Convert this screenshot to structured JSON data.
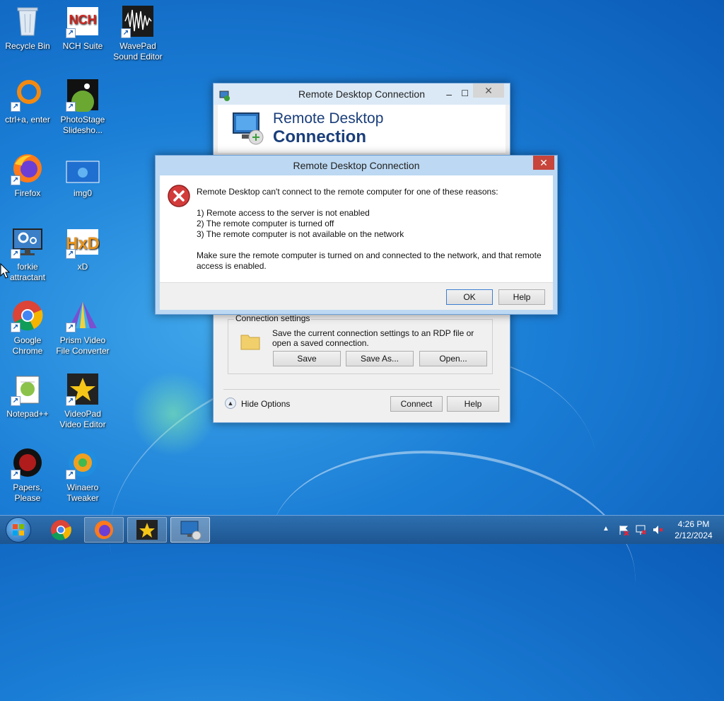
{
  "desktop": {
    "icons": [
      {
        "label": "Recycle Bin"
      },
      {
        "label": "NCH Suite"
      },
      {
        "label": "WavePad Sound Editor"
      },
      {
        "label": "ctrl+a, enter"
      },
      {
        "label": "PhotoStage Slidesho..."
      },
      {
        "label": "Firefox"
      },
      {
        "label": "img0"
      },
      {
        "label": "forkie attractant"
      },
      {
        "label": "xD"
      },
      {
        "label": "Google Chrome"
      },
      {
        "label": "Prism Video File Converter"
      },
      {
        "label": "Notepad++"
      },
      {
        "label": "VideoPad Video Editor"
      },
      {
        "label": "Papers, Please"
      },
      {
        "label": "Winaero Tweaker"
      }
    ]
  },
  "rdc_window": {
    "title": "Remote Desktop Connection",
    "banner_line1": "Remote Desktop",
    "banner_line2": "Connection",
    "connection_settings_label": "Connection settings",
    "connection_settings_text": "Save the current connection settings to an RDP file or open a saved connection.",
    "save_label": "Save",
    "save_as_label": "Save As...",
    "open_label": "Open...",
    "hide_options_label": "Hide Options",
    "connect_label": "Connect",
    "help_label": "Help"
  },
  "error_dialog": {
    "title": "Remote Desktop Connection",
    "intro": "Remote Desktop can't connect to the remote computer for one of these reasons:",
    "reason1": "1) Remote access to the server is not enabled",
    "reason2": "2) The remote computer is turned off",
    "reason3": "3) The remote computer is not available on the network",
    "advice": "Make sure the remote computer is turned on and connected to the network, and that remote access is enabled.",
    "ok_label": "OK",
    "help_label": "Help"
  },
  "taskbar": {
    "time": "4:26 PM",
    "date": "2/12/2024"
  }
}
